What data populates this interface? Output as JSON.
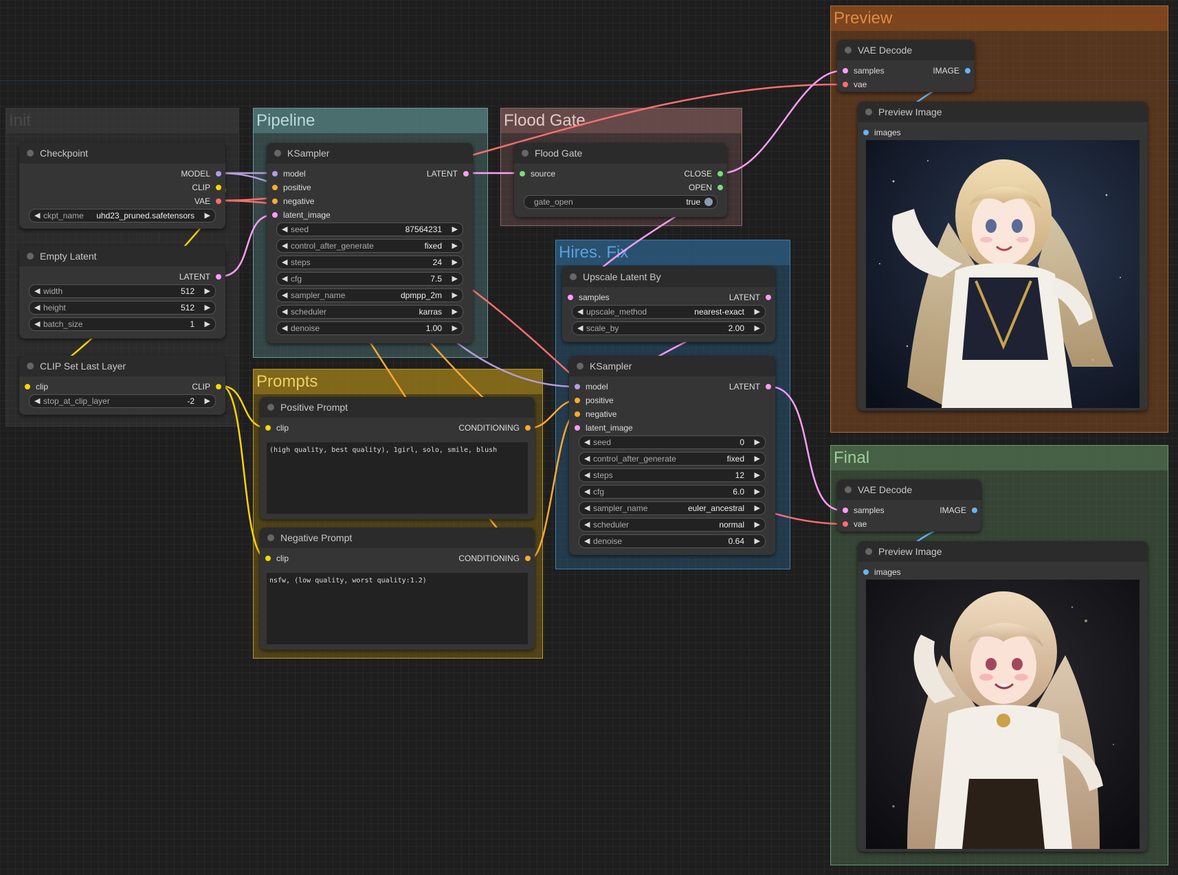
{
  "colors": {
    "model": "#b39ddb",
    "clip": "#ffd500",
    "vae": "#ff6e6e",
    "latent": "#ff9cf9",
    "conditioning": "#ffa931",
    "image": "#64b5f6",
    "gate": "#7cdb7c"
  },
  "groups": {
    "init": "Init",
    "pipeline": "Pipeline",
    "floodgate": "Flood Gate",
    "prompts": "Prompts",
    "hires": "Hires. Fix",
    "preview": "Preview",
    "final": "Final"
  },
  "checkpoint": {
    "title": "Checkpoint",
    "outputs": [
      "MODEL",
      "CLIP",
      "VAE"
    ],
    "widget_label": "ckpt_name",
    "widget_value": "uhd23_pruned.safetensors"
  },
  "empty_latent": {
    "title": "Empty Latent",
    "output": "LATENT",
    "widgets": [
      {
        "label": "width",
        "value": "512"
      },
      {
        "label": "height",
        "value": "512"
      },
      {
        "label": "batch_size",
        "value": "1"
      }
    ]
  },
  "clip_set": {
    "title": "CLIP Set Last Layer",
    "input": "clip",
    "output": "CLIP",
    "widget_label": "stop_at_clip_layer",
    "widget_value": "-2"
  },
  "ksampler1": {
    "title": "KSampler",
    "inputs": [
      "model",
      "positive",
      "negative",
      "latent_image"
    ],
    "output": "LATENT",
    "widgets": [
      {
        "label": "seed",
        "value": "87564231"
      },
      {
        "label": "control_after_generate",
        "value": "fixed"
      },
      {
        "label": "steps",
        "value": "24"
      },
      {
        "label": "cfg",
        "value": "7.5"
      },
      {
        "label": "sampler_name",
        "value": "dpmpp_2m"
      },
      {
        "label": "scheduler",
        "value": "karras"
      },
      {
        "label": "denoise",
        "value": "1.00"
      }
    ]
  },
  "floodgate": {
    "title": "Flood Gate",
    "input": "source",
    "outputs": [
      "CLOSE",
      "OPEN"
    ],
    "toggle_label": "gate_open",
    "toggle_value": "true"
  },
  "positive": {
    "title": "Positive Prompt",
    "input": "clip",
    "output": "CONDITIONING",
    "text": "(high quality, best quality), 1girl, solo, smile, blush"
  },
  "negative": {
    "title": "Negative Prompt",
    "input": "clip",
    "output": "CONDITIONING",
    "text": "nsfw, (low quality, worst quality:1.2)"
  },
  "upscale": {
    "title": "Upscale Latent By",
    "input": "samples",
    "output": "LATENT",
    "widgets": [
      {
        "label": "upscale_method",
        "value": "nearest-exact"
      },
      {
        "label": "scale_by",
        "value": "2.00"
      }
    ]
  },
  "ksampler2": {
    "title": "KSampler",
    "inputs": [
      "model",
      "positive",
      "negative",
      "latent_image"
    ],
    "output": "LATENT",
    "widgets": [
      {
        "label": "seed",
        "value": "0"
      },
      {
        "label": "control_after_generate",
        "value": "fixed"
      },
      {
        "label": "steps",
        "value": "12"
      },
      {
        "label": "cfg",
        "value": "6.0"
      },
      {
        "label": "sampler_name",
        "value": "euler_ancestral"
      },
      {
        "label": "scheduler",
        "value": "normal"
      },
      {
        "label": "denoise",
        "value": "0.64"
      }
    ]
  },
  "vae_preview": {
    "title": "VAE Decode",
    "inputs": [
      "samples",
      "vae"
    ],
    "output": "IMAGE"
  },
  "preview_img": {
    "title": "Preview Image",
    "input": "images"
  },
  "vae_final": {
    "title": "VAE Decode",
    "inputs": [
      "samples",
      "vae"
    ],
    "output": "IMAGE"
  },
  "final_img": {
    "title": "Preview Image",
    "input": "images"
  },
  "icons": {
    "arrow_left": "◀",
    "arrow_right": "▶"
  }
}
